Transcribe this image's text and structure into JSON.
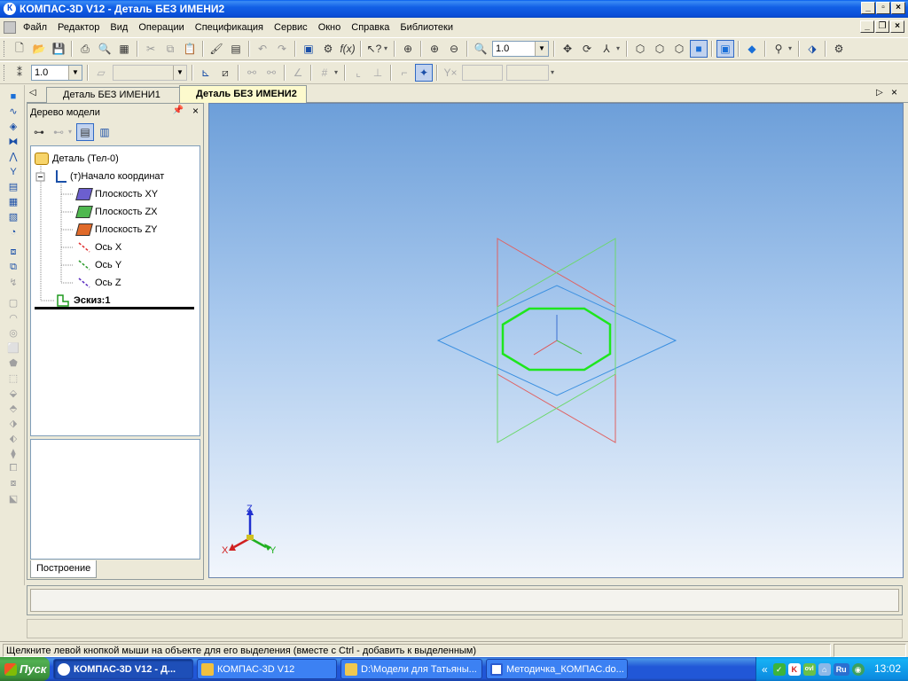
{
  "window": {
    "title": "КОМПАС-3D V12 - Деталь БЕЗ ИМЕНИ2",
    "app_icon": "kompas-logo-icon"
  },
  "menu": [
    "Файл",
    "Редактор",
    "Вид",
    "Операции",
    "Спецификация",
    "Сервис",
    "Окно",
    "Справка",
    "Библиотеки"
  ],
  "toolbar": {
    "zoom_value": "1.0",
    "step_value": "1.0"
  },
  "tabs": [
    {
      "label": "Деталь БЕЗ ИМЕНИ1",
      "active": false
    },
    {
      "label": "Деталь БЕЗ ИМЕНИ2",
      "active": true
    }
  ],
  "tree_panel": {
    "title": "Дерево модели",
    "root": "Деталь (Тел-0)",
    "origin": "(т)Начало координат",
    "items": [
      "Плоскость XY",
      "Плоскость ZX",
      "Плоскость ZY",
      "Ось X",
      "Ось Y",
      "Ось Z"
    ],
    "sketch": "Эскиз:1",
    "tab_label": "Построение"
  },
  "viewport": {
    "axis_labels": {
      "x": "X",
      "y": "Y",
      "z": "Z"
    }
  },
  "colors": {
    "plane_xy": "#3a8fe0",
    "plane_zx": "#6cd86c",
    "plane_zy": "#e06060",
    "sketch": "#1ee61e"
  },
  "status_text": "Щелкните левой кнопкой мыши на объекте для его выделения (вместе с Ctrl - добавить к выделенным)",
  "taskbar": {
    "start_label": "Пуск",
    "tasks": [
      {
        "label": "КОМПАС-3D V12 - Д...",
        "active": true
      },
      {
        "label": "КОМПАС-3D V12",
        "active": false
      },
      {
        "label": "D:\\Модели для Татьяны...",
        "active": false
      },
      {
        "label": "Методичка_КОМПАС.do...",
        "active": false
      }
    ],
    "tray": {
      "chevron": "«",
      "lang": "Ru",
      "clock": "13:02"
    }
  }
}
